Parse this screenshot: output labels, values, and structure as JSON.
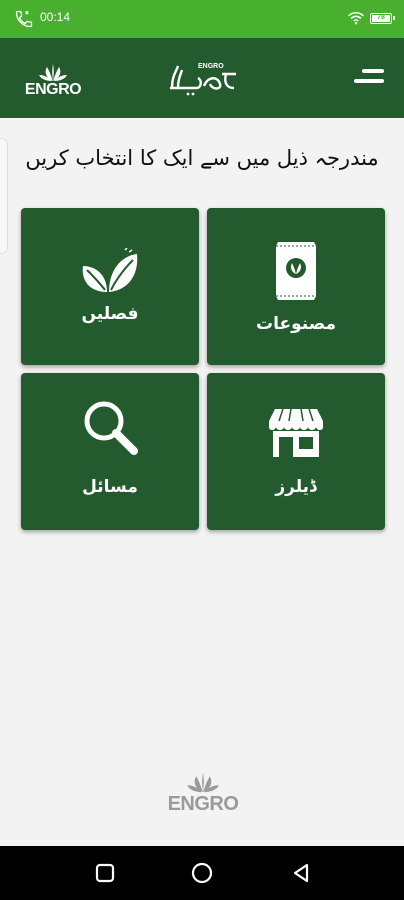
{
  "status_bar": {
    "time": "00:14",
    "battery": "78",
    "icons": [
      "call-icon",
      "wifi-icon",
      "battery-icon"
    ]
  },
  "header": {
    "logo_text": "ENGRO",
    "brand_text": "ENGRO",
    "menu_icon": "hamburger-menu-icon"
  },
  "prompt": "مندرجہ ذیل میں سے ایک کا انتخاب کریں",
  "tiles": [
    {
      "label": "مصنوعات",
      "icon": "fertilizer-bag-icon"
    },
    {
      "label": "فصلیں",
      "icon": "leaves-icon"
    },
    {
      "label": "ڈیلرز",
      "icon": "shop-icon"
    },
    {
      "label": "مسائل",
      "icon": "magnifier-icon"
    }
  ],
  "footer": {
    "logo_text": "ENGRO"
  },
  "colors": {
    "status_bar": "#48b02e",
    "header": "#235b2f",
    "tile": "#235b2f",
    "background": "#f3f3f3",
    "nav_bar": "#000000",
    "footer_logo": "#9a9a9a"
  },
  "nav": {
    "recents": "square-icon",
    "home": "circle-icon",
    "back": "triangle-back-icon"
  }
}
